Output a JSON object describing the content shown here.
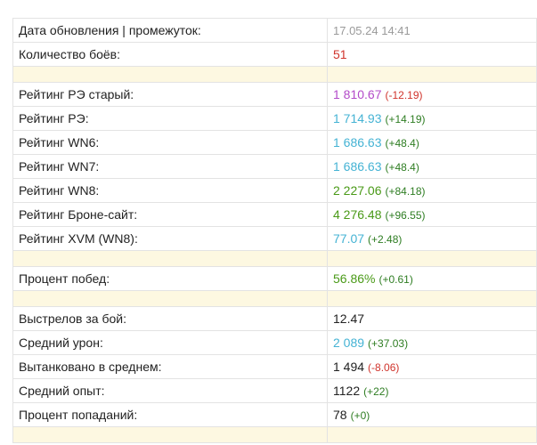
{
  "colors": {
    "purple": "#b34bc9",
    "cyan": "#45b3d4",
    "green": "#4a9a18",
    "red": "#d0342c",
    "gray": "#9a9a9a",
    "dark": "#222222",
    "delta_positive": "#2e7d22",
    "delta_negative": "#d0342c"
  },
  "rows": [
    {
      "type": "row",
      "name": "update-date",
      "label": "Дата обновления | промежуток:",
      "value": "17.05.24 14:41",
      "value_color": "gray",
      "is_date": true
    },
    {
      "type": "row",
      "name": "battle-count",
      "label": "Количество боёв:",
      "value": "51",
      "value_color": "red"
    },
    {
      "type": "spacer"
    },
    {
      "type": "row",
      "name": "rating-re-old",
      "label": "Рейтинг РЭ старый:",
      "value": "1 810.67",
      "value_color": "purple",
      "delta": "(-12.19)",
      "delta_sign": "negative"
    },
    {
      "type": "row",
      "name": "rating-re",
      "label": "Рейтинг РЭ:",
      "value": "1 714.93",
      "value_color": "cyan",
      "delta": "(+14.19)",
      "delta_sign": "positive"
    },
    {
      "type": "row",
      "name": "rating-wn6",
      "label": "Рейтинг WN6:",
      "value": "1 686.63",
      "value_color": "cyan",
      "delta": "(+48.4)",
      "delta_sign": "positive"
    },
    {
      "type": "row",
      "name": "rating-wn7",
      "label": "Рейтинг WN7:",
      "value": "1 686.63",
      "value_color": "cyan",
      "delta": "(+48.4)",
      "delta_sign": "positive"
    },
    {
      "type": "row",
      "name": "rating-wn8",
      "label": "Рейтинг WN8:",
      "value": "2 227.06",
      "value_color": "green",
      "delta": "(+84.18)",
      "delta_sign": "positive"
    },
    {
      "type": "row",
      "name": "rating-brone",
      "label": "Рейтинг Броне-сайт:",
      "value": "4 276.48",
      "value_color": "green",
      "delta": "(+96.55)",
      "delta_sign": "positive"
    },
    {
      "type": "row",
      "name": "rating-xvm",
      "label": "Рейтинг XVM (WN8):",
      "value": "77.07",
      "value_color": "cyan",
      "delta": "(+2.48)",
      "delta_sign": "positive"
    },
    {
      "type": "spacer"
    },
    {
      "type": "row",
      "name": "win-rate",
      "label": "Процент побед:",
      "value": "56.86%",
      "value_color": "green",
      "delta": "(+0.61)",
      "delta_sign": "positive"
    },
    {
      "type": "spacer"
    },
    {
      "type": "row",
      "name": "shots-per-battle",
      "label": "Выстрелов за бой:",
      "value": "12.47",
      "value_color": "dark"
    },
    {
      "type": "row",
      "name": "avg-damage",
      "label": "Средний урон:",
      "value": "2 089",
      "value_color": "cyan",
      "delta": "(+37.03)",
      "delta_sign": "positive"
    },
    {
      "type": "row",
      "name": "avg-tanked",
      "label": "Вытанковано в среднем:",
      "value": "1 494",
      "value_color": "dark",
      "delta": "(-8.06)",
      "delta_sign": "negative"
    },
    {
      "type": "row",
      "name": "avg-xp",
      "label": "Средний опыт:",
      "value": "1122",
      "value_color": "dark",
      "delta": "(+22)",
      "delta_sign": "positive"
    },
    {
      "type": "row",
      "name": "hit-rate",
      "label": "Процент попаданий:",
      "value": "78",
      "value_color": "dark",
      "delta": "(+0)",
      "delta_sign": "positive"
    },
    {
      "type": "spacer"
    }
  ]
}
